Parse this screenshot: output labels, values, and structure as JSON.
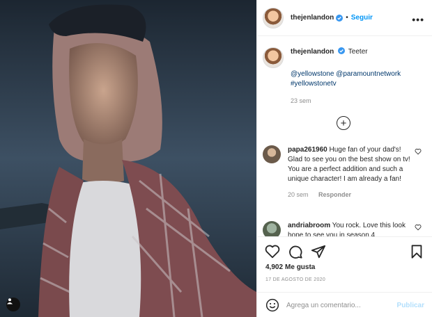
{
  "post": {
    "username": "thejenlandon",
    "follow_label": "Seguir",
    "more_label": "•••",
    "separator": "•",
    "caption": {
      "text": "Teeter",
      "tags": "@yellowstone @paramountnetwork #yellowstonetv",
      "time": "23 sem"
    },
    "load_more": "+"
  },
  "comments": [
    {
      "username": "papa261960",
      "text": "Huge fan of your dad's! Glad to see you on the best show on tv! You are a perfect addition and such a unique character! I am already a fan!",
      "time": "20 sem",
      "reply": "Responder"
    },
    {
      "username": "andriabroom",
      "text": "You rock. Love this look hope to see you in season 4",
      "time": "",
      "reply": ""
    }
  ],
  "stats": {
    "likes_count": "4,902",
    "likes_label": "Me gusta",
    "date": "17 DE AGOSTO DE 2020"
  },
  "composer": {
    "placeholder": "Agrega un comentario...",
    "publish_label": "Publicar"
  },
  "colors": {
    "accent": "#0095f6",
    "link": "#00376b",
    "muted": "#8e8e8e"
  },
  "icons": [
    "verified-badge-icon",
    "more-options-icon",
    "plus-circle-icon",
    "heart-icon",
    "comment-icon",
    "share-icon",
    "bookmark-icon",
    "emoji-icon",
    "user-tag-icon"
  ]
}
